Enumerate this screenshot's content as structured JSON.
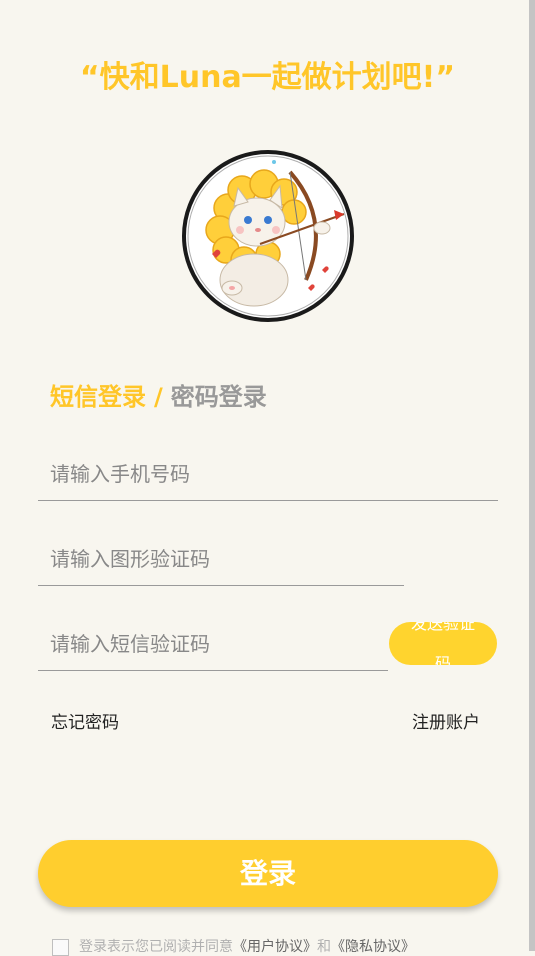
{
  "slogan": "“快和Luna一起做计划吧!”",
  "tabs": {
    "sms": "短信登录",
    "separator": "/",
    "password": "密码登录",
    "active": "sms"
  },
  "form": {
    "phone_placeholder": "请输入手机号码",
    "captcha_placeholder": "请输入图形验证码",
    "sms_code_placeholder": "请输入短信验证码",
    "send_code_label": "发送验证码"
  },
  "links": {
    "forgot_password": "忘记密码",
    "register": "注册账户"
  },
  "login_button": "登录",
  "agreement": {
    "prefix": "登录表示您已阅读并同意",
    "user_agreement": "《用户协议》",
    "and": "和",
    "privacy_policy": "《隐私协议》"
  },
  "colors": {
    "accent": "#ffc629",
    "button": "#ffce2e",
    "background": "#f8f6ef"
  }
}
